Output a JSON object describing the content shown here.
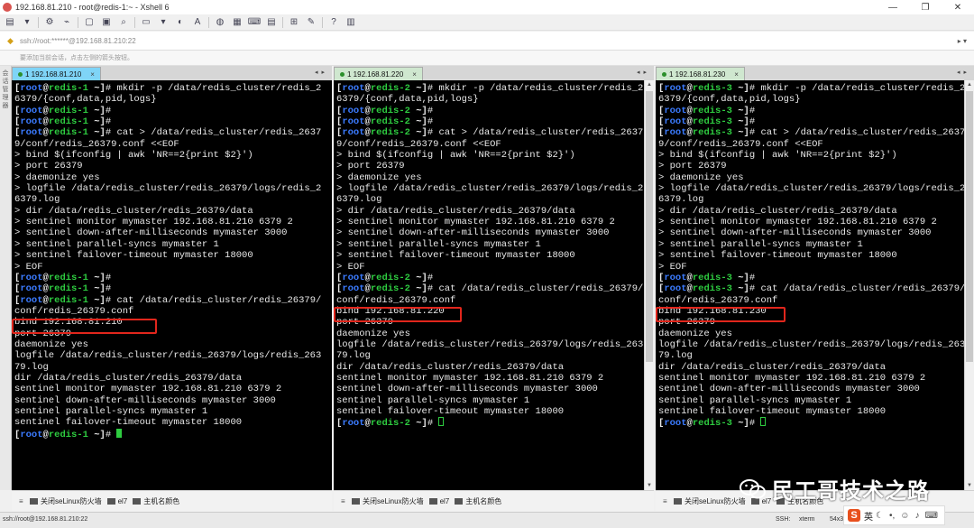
{
  "window": {
    "title": "192.168.81.210 - root@redis-1:~ - Xshell 6"
  },
  "window_controls": [
    "—",
    "❐",
    "✕"
  ],
  "addressbar": {
    "address": "ssh://root:******@192.168.81.210:22"
  },
  "hintbar": {
    "text": "要添加当前会话，点击左侧的箭头按钮。"
  },
  "leftstrip": {
    "text": "会话管理器"
  },
  "panes": [
    {
      "tab": "1 192.168.81.210",
      "lines": [
        [
          {
            "t": "[",
            "c": "pr-br"
          },
          {
            "t": "root",
            "c": "pr-user"
          },
          {
            "t": "@",
            "c": "pr-br"
          },
          {
            "t": "redis-1",
            "c": "pr-host"
          },
          {
            "t": " ~]",
            "c": "pr-br"
          },
          {
            "t": "# mkdir -p /data/redis_cluster/redis_2"
          }
        ],
        [
          {
            "t": "6379/{conf,data,pid,logs}"
          }
        ],
        [
          {
            "t": "[",
            "c": "pr-br"
          },
          {
            "t": "root",
            "c": "pr-user"
          },
          {
            "t": "@",
            "c": "pr-br"
          },
          {
            "t": "redis-1",
            "c": "pr-host"
          },
          {
            "t": " ~]",
            "c": "pr-br"
          },
          {
            "t": "#"
          }
        ],
        [
          {
            "t": "[",
            "c": "pr-br"
          },
          {
            "t": "root",
            "c": "pr-user"
          },
          {
            "t": "@",
            "c": "pr-br"
          },
          {
            "t": "redis-1",
            "c": "pr-host"
          },
          {
            "t": " ~]",
            "c": "pr-br"
          },
          {
            "t": "#"
          }
        ],
        [
          {
            "t": "[",
            "c": "pr-br"
          },
          {
            "t": "root",
            "c": "pr-user"
          },
          {
            "t": "@",
            "c": "pr-br"
          },
          {
            "t": "redis-1",
            "c": "pr-host"
          },
          {
            "t": " ~]",
            "c": "pr-br"
          },
          {
            "t": "# cat > /data/redis_cluster/redis_2637"
          }
        ],
        [
          {
            "t": "9/conf/redis_26379.conf <<EOF"
          }
        ],
        [
          {
            "t": "> bind $(ifconfig | awk 'NR==2{print $2}')"
          }
        ],
        [
          {
            "t": "> port 26379"
          }
        ],
        [
          {
            "t": "> daemonize yes"
          }
        ],
        [
          {
            "t": "> logfile /data/redis_cluster/redis_26379/logs/redis_2"
          }
        ],
        [
          {
            "t": "6379.log"
          }
        ],
        [
          {
            "t": "> dir /data/redis_cluster/redis_26379/data"
          }
        ],
        [
          {
            "t": "> sentinel monitor mymaster 192.168.81.210 6379 2"
          }
        ],
        [
          {
            "t": "> sentinel down-after-milliseconds mymaster 3000"
          }
        ],
        [
          {
            "t": "> sentinel parallel-syncs mymaster 1"
          }
        ],
        [
          {
            "t": "> sentinel failover-timeout mymaster 18000"
          }
        ],
        [
          {
            "t": "> EOF"
          }
        ],
        [
          {
            "t": "[",
            "c": "pr-br"
          },
          {
            "t": "root",
            "c": "pr-user"
          },
          {
            "t": "@",
            "c": "pr-br"
          },
          {
            "t": "redis-1",
            "c": "pr-host"
          },
          {
            "t": " ~]",
            "c": "pr-br"
          },
          {
            "t": "#"
          }
        ],
        [
          {
            "t": "[",
            "c": "pr-br"
          },
          {
            "t": "root",
            "c": "pr-user"
          },
          {
            "t": "@",
            "c": "pr-br"
          },
          {
            "t": "redis-1",
            "c": "pr-host"
          },
          {
            "t": " ~]",
            "c": "pr-br"
          },
          {
            "t": "#"
          }
        ],
        [
          {
            "t": "[",
            "c": "pr-br"
          },
          {
            "t": "root",
            "c": "pr-user"
          },
          {
            "t": "@",
            "c": "pr-br"
          },
          {
            "t": "redis-1",
            "c": "pr-host"
          },
          {
            "t": " ~]",
            "c": "pr-br"
          },
          {
            "t": "# cat /data/redis_cluster/redis_26379/"
          }
        ],
        [
          {
            "t": "conf/redis_26379.conf"
          }
        ],
        [
          {
            "t": "bind 192.168.81.210"
          }
        ],
        [
          {
            "t": "port 26379"
          }
        ],
        [
          {
            "t": "daemonize yes"
          }
        ],
        [
          {
            "t": "logfile /data/redis_cluster/redis_26379/logs/redis_263"
          }
        ],
        [
          {
            "t": "79.log"
          }
        ],
        [
          {
            "t": "dir /data/redis_cluster/redis_26379/data"
          }
        ],
        [
          {
            "t": "sentinel monitor mymaster 192.168.81.210 6379 2"
          }
        ],
        [
          {
            "t": "sentinel down-after-milliseconds mymaster 3000"
          }
        ],
        [
          {
            "t": "sentinel parallel-syncs mymaster 1"
          }
        ],
        [
          {
            "t": "sentinel failover-timeout mymaster 18000"
          }
        ],
        [
          {
            "t": "[",
            "c": "pr-br"
          },
          {
            "t": "root",
            "c": "pr-user"
          },
          {
            "t": "@",
            "c": "pr-br"
          },
          {
            "t": "redis-1",
            "c": "pr-host"
          },
          {
            "t": " ~]",
            "c": "pr-br"
          },
          {
            "t": "# "
          },
          {
            "cursor": "solid"
          }
        ]
      ],
      "quickbar": [
        "关闭seLinux防火墙",
        "el7",
        "主机名颜色"
      ]
    },
    {
      "tab": "1 192.168.81.220",
      "lines": [
        [
          {
            "t": "[",
            "c": "pr-br"
          },
          {
            "t": "root",
            "c": "pr-user"
          },
          {
            "t": "@",
            "c": "pr-br"
          },
          {
            "t": "redis-2",
            "c": "pr-host"
          },
          {
            "t": " ~]",
            "c": "pr-br"
          },
          {
            "t": "# mkdir -p /data/redis_cluster/redis_2"
          }
        ],
        [
          {
            "t": "6379/{conf,data,pid,logs}"
          }
        ],
        [
          {
            "t": "[",
            "c": "pr-br"
          },
          {
            "t": "root",
            "c": "pr-user"
          },
          {
            "t": "@",
            "c": "pr-br"
          },
          {
            "t": "redis-2",
            "c": "pr-host"
          },
          {
            "t": " ~]",
            "c": "pr-br"
          },
          {
            "t": "#"
          }
        ],
        [
          {
            "t": "[",
            "c": "pr-br"
          },
          {
            "t": "root",
            "c": "pr-user"
          },
          {
            "t": "@",
            "c": "pr-br"
          },
          {
            "t": "redis-2",
            "c": "pr-host"
          },
          {
            "t": " ~]",
            "c": "pr-br"
          },
          {
            "t": "#"
          }
        ],
        [
          {
            "t": "[",
            "c": "pr-br"
          },
          {
            "t": "root",
            "c": "pr-user"
          },
          {
            "t": "@",
            "c": "pr-br"
          },
          {
            "t": "redis-2",
            "c": "pr-host"
          },
          {
            "t": " ~]",
            "c": "pr-br"
          },
          {
            "t": "# cat > /data/redis_cluster/redis_2637"
          }
        ],
        [
          {
            "t": "9/conf/redis_26379.conf <<EOF"
          }
        ],
        [
          {
            "t": "> bind $(ifconfig | awk 'NR==2{print $2}')"
          }
        ],
        [
          {
            "t": "> port 26379"
          }
        ],
        [
          {
            "t": "> daemonize yes"
          }
        ],
        [
          {
            "t": "> logfile /data/redis_cluster/redis_26379/logs/redis_2"
          }
        ],
        [
          {
            "t": "6379.log"
          }
        ],
        [
          {
            "t": "> dir /data/redis_cluster/redis_26379/data"
          }
        ],
        [
          {
            "t": "> sentinel monitor mymaster 192.168.81.210 6379 2"
          }
        ],
        [
          {
            "t": "> sentinel down-after-milliseconds mymaster 3000"
          }
        ],
        [
          {
            "t": "> sentinel parallel-syncs mymaster 1"
          }
        ],
        [
          {
            "t": "> sentinel failover-timeout mymaster 18000"
          }
        ],
        [
          {
            "t": "> EOF"
          }
        ],
        [
          {
            "t": "[",
            "c": "pr-br"
          },
          {
            "t": "root",
            "c": "pr-user"
          },
          {
            "t": "@",
            "c": "pr-br"
          },
          {
            "t": "redis-2",
            "c": "pr-host"
          },
          {
            "t": " ~]",
            "c": "pr-br"
          },
          {
            "t": "#"
          }
        ],
        [
          {
            "t": "[",
            "c": "pr-br"
          },
          {
            "t": "root",
            "c": "pr-user"
          },
          {
            "t": "@",
            "c": "pr-br"
          },
          {
            "t": "redis-2",
            "c": "pr-host"
          },
          {
            "t": " ~]",
            "c": "pr-br"
          },
          {
            "t": "# cat /data/redis_cluster/redis_26379/"
          }
        ],
        [
          {
            "t": "conf/redis_26379.conf"
          }
        ],
        [
          {
            "t": "bind 192.168.81.220"
          }
        ],
        [
          {
            "t": "port 26379"
          }
        ],
        [
          {
            "t": "daemonize yes"
          }
        ],
        [
          {
            "t": "logfile /data/redis_cluster/redis_26379/logs/redis_263"
          }
        ],
        [
          {
            "t": "79.log"
          }
        ],
        [
          {
            "t": "dir /data/redis_cluster/redis_26379/data"
          }
        ],
        [
          {
            "t": "sentinel monitor mymaster 192.168.81.210 6379 2"
          }
        ],
        [
          {
            "t": "sentinel down-after-milliseconds mymaster 3000"
          }
        ],
        [
          {
            "t": "sentinel parallel-syncs mymaster 1"
          }
        ],
        [
          {
            "t": "sentinel failover-timeout mymaster 18000"
          }
        ],
        [
          {
            "t": "[",
            "c": "pr-br"
          },
          {
            "t": "root",
            "c": "pr-user"
          },
          {
            "t": "@",
            "c": "pr-br"
          },
          {
            "t": "redis-2",
            "c": "pr-host"
          },
          {
            "t": " ~]",
            "c": "pr-br"
          },
          {
            "t": "# "
          },
          {
            "cursor": "hollow"
          }
        ]
      ],
      "quickbar": [
        "关闭seLinux防火墙",
        "el7",
        "主机名颜色"
      ]
    },
    {
      "tab": "1 192.168.81.230",
      "lines": [
        [
          {
            "t": "[",
            "c": "pr-br"
          },
          {
            "t": "root",
            "c": "pr-user"
          },
          {
            "t": "@",
            "c": "pr-br"
          },
          {
            "t": "redis-3",
            "c": "pr-host"
          },
          {
            "t": " ~]",
            "c": "pr-br"
          },
          {
            "t": "# mkdir -p /data/redis_cluster/redis_2"
          }
        ],
        [
          {
            "t": "6379/{conf,data,pid,logs}"
          }
        ],
        [
          {
            "t": "[",
            "c": "pr-br"
          },
          {
            "t": "root",
            "c": "pr-user"
          },
          {
            "t": "@",
            "c": "pr-br"
          },
          {
            "t": "redis-3",
            "c": "pr-host"
          },
          {
            "t": " ~]",
            "c": "pr-br"
          },
          {
            "t": "#"
          }
        ],
        [
          {
            "t": "[",
            "c": "pr-br"
          },
          {
            "t": "root",
            "c": "pr-user"
          },
          {
            "t": "@",
            "c": "pr-br"
          },
          {
            "t": "redis-3",
            "c": "pr-host"
          },
          {
            "t": " ~]",
            "c": "pr-br"
          },
          {
            "t": "#"
          }
        ],
        [
          {
            "t": "[",
            "c": "pr-br"
          },
          {
            "t": "root",
            "c": "pr-user"
          },
          {
            "t": "@",
            "c": "pr-br"
          },
          {
            "t": "redis-3",
            "c": "pr-host"
          },
          {
            "t": " ~]",
            "c": "pr-br"
          },
          {
            "t": "# cat > /data/redis_cluster/redis_2637"
          }
        ],
        [
          {
            "t": "9/conf/redis_26379.conf <<EOF"
          }
        ],
        [
          {
            "t": "> bind $(ifconfig | awk 'NR==2{print $2}')"
          }
        ],
        [
          {
            "t": "> port 26379"
          }
        ],
        [
          {
            "t": "> daemonize yes"
          }
        ],
        [
          {
            "t": "> logfile /data/redis_cluster/redis_26379/logs/redis_2"
          }
        ],
        [
          {
            "t": "6379.log"
          }
        ],
        [
          {
            "t": "> dir /data/redis_cluster/redis_26379/data"
          }
        ],
        [
          {
            "t": "> sentinel monitor mymaster 192.168.81.210 6379 2"
          }
        ],
        [
          {
            "t": "> sentinel down-after-milliseconds mymaster 3000"
          }
        ],
        [
          {
            "t": "> sentinel parallel-syncs mymaster 1"
          }
        ],
        [
          {
            "t": "> sentinel failover-timeout mymaster 18000"
          }
        ],
        [
          {
            "t": "> EOF"
          }
        ],
        [
          {
            "t": "[",
            "c": "pr-br"
          },
          {
            "t": "root",
            "c": "pr-user"
          },
          {
            "t": "@",
            "c": "pr-br"
          },
          {
            "t": "redis-3",
            "c": "pr-host"
          },
          {
            "t": " ~]",
            "c": "pr-br"
          },
          {
            "t": "#"
          }
        ],
        [
          {
            "t": "[",
            "c": "pr-br"
          },
          {
            "t": "root",
            "c": "pr-user"
          },
          {
            "t": "@",
            "c": "pr-br"
          },
          {
            "t": "redis-3",
            "c": "pr-host"
          },
          {
            "t": " ~]",
            "c": "pr-br"
          },
          {
            "t": "# cat /data/redis_cluster/redis_26379/"
          }
        ],
        [
          {
            "t": "conf/redis_26379.conf"
          }
        ],
        [
          {
            "t": "bind 192.168.81.230"
          }
        ],
        [
          {
            "t": "port 26379"
          }
        ],
        [
          {
            "t": "daemonize yes"
          }
        ],
        [
          {
            "t": "logfile /data/redis_cluster/redis_26379/logs/redis_263"
          }
        ],
        [
          {
            "t": "79.log"
          }
        ],
        [
          {
            "t": "dir /data/redis_cluster/redis_26379/data"
          }
        ],
        [
          {
            "t": "sentinel monitor mymaster 192.168.81.210 6379 2"
          }
        ],
        [
          {
            "t": "sentinel down-after-milliseconds mymaster 3000"
          }
        ],
        [
          {
            "t": "sentinel parallel-syncs mymaster 1"
          }
        ],
        [
          {
            "t": "sentinel failover-timeout mymaster 18000"
          }
        ],
        [
          {
            "t": "[",
            "c": "pr-br"
          },
          {
            "t": "root",
            "c": "pr-user"
          },
          {
            "t": "@",
            "c": "pr-br"
          },
          {
            "t": "redis-3",
            "c": "pr-host"
          },
          {
            "t": " ~]",
            "c": "pr-br"
          },
          {
            "t": "# "
          },
          {
            "cursor": "hollow"
          }
        ]
      ],
      "quickbar": [
        "关闭seLinux防火墙",
        "el7",
        "主机名颜色"
      ]
    }
  ],
  "statusbar": {
    "left": "ssh://root@192.168.81.210:22",
    "ssh": "SSH:",
    "term": "xterm",
    "size": "54x36"
  },
  "ime": {
    "lang": "英"
  },
  "watermark": {
    "text": "民工哥技术之路"
  },
  "colors": {
    "prompt_user": "#3b7bff",
    "prompt_host": "#2ecc40",
    "highlight": "#e1261c",
    "tab_active": "#7fd4f7"
  }
}
